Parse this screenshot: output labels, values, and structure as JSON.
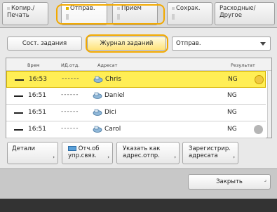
{
  "tabs": [
    {
      "line1": "Копир./",
      "line2": "Печать",
      "active": false
    },
    {
      "line1": "Отправ.",
      "line2": "",
      "active": true
    },
    {
      "line1": "Прием",
      "line2": "",
      "active": false
    },
    {
      "line1": "Сохрак.",
      "line2": "",
      "active": false
    },
    {
      "line1": "Расходные/",
      "line2": "Другое",
      "active": false
    }
  ],
  "mode": {
    "status_label": "Сост. задания",
    "log_label": "Журнал заданий",
    "dropdown_value": "Отправ."
  },
  "table": {
    "headers": {
      "time": "Врем",
      "job_id": "ИД.отд.",
      "dest": "Адресат",
      "result": "Результат"
    },
    "rows": [
      {
        "time": "16:53",
        "job_id": "------",
        "dest": "Chris",
        "result": "NG",
        "selected": true,
        "has_circle": true
      },
      {
        "time": "16:51",
        "job_id": "------",
        "dest": "Daniel",
        "result": "NG",
        "selected": false,
        "has_circle": false
      },
      {
        "time": "16:51",
        "job_id": "------",
        "dest": "Dici",
        "result": "NG",
        "selected": false,
        "has_circle": false
      },
      {
        "time": "16:51",
        "job_id": "------",
        "dest": "Carol",
        "result": "NG",
        "selected": false,
        "has_circle": true
      }
    ]
  },
  "actions": {
    "details": {
      "line1": "Детали",
      "line2": ""
    },
    "report": {
      "line1": "Отч.об",
      "line2": "упр.связ."
    },
    "specify": {
      "line1": "Указать как",
      "line2": "адрес.отпр."
    },
    "register": {
      "line1": "Зарегистрир.",
      "line2": "адресата"
    }
  },
  "close_label": "Закрыть",
  "colors": {
    "accent_orange": "#f2a900",
    "selected_row": "#ffee55"
  }
}
